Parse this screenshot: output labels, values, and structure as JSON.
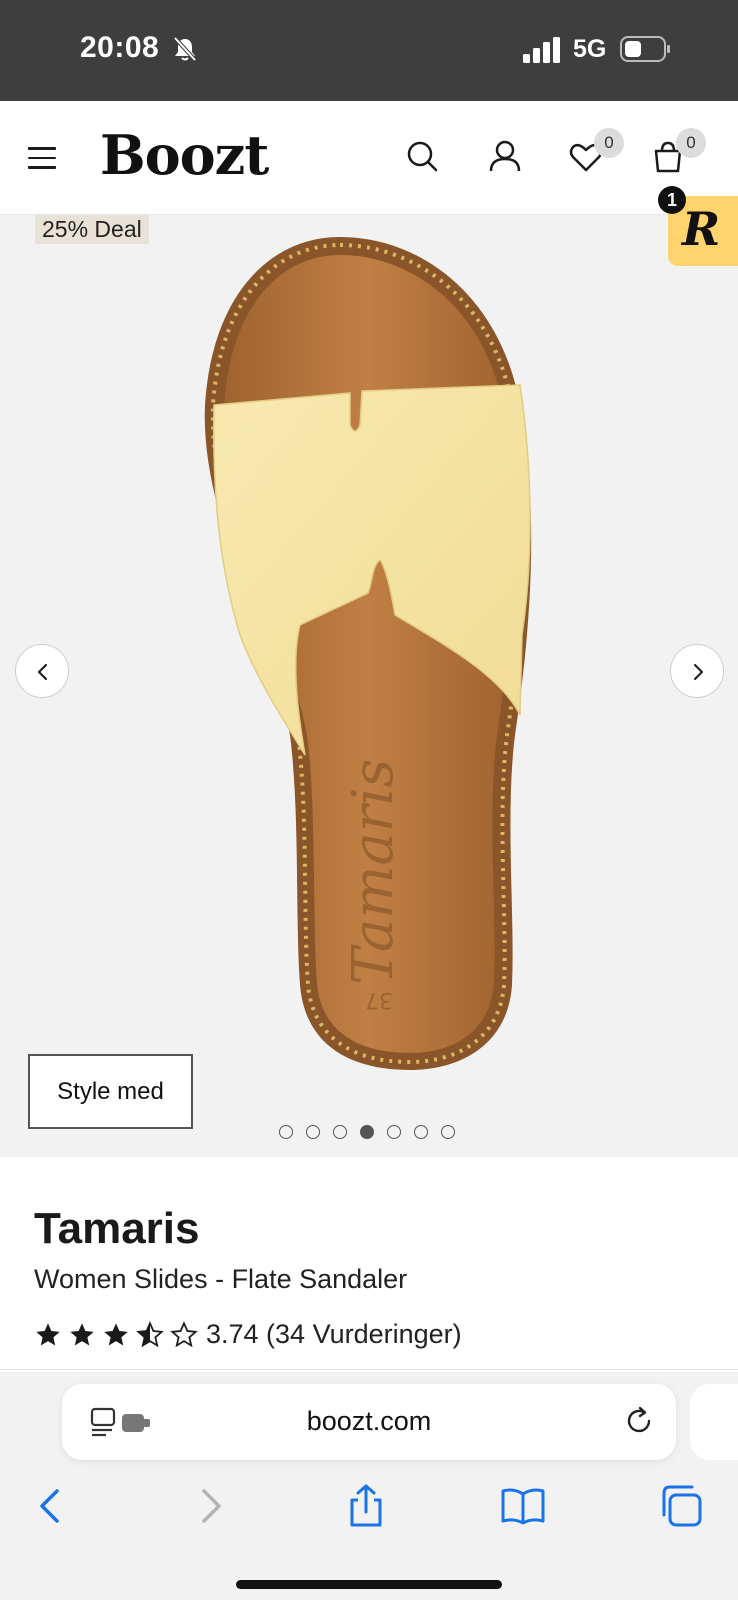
{
  "status_bar": {
    "time": "20:08",
    "network": "5G",
    "icons": [
      "bell-slash-icon",
      "signal-icon",
      "battery-icon"
    ]
  },
  "header": {
    "logo": "Boozt",
    "wishlist_count": "0",
    "cart_count": "0",
    "icons": [
      "menu-icon",
      "search-icon",
      "account-icon",
      "heart-icon",
      "bag-icon"
    ]
  },
  "gallery": {
    "deal_label": "25% Deal",
    "style_button": "Style med",
    "dot_count": 7,
    "active_dot": 4,
    "image_description": "tamaris-slide-sandal",
    "icons": [
      "chevron-left-icon",
      "chevron-right-icon"
    ]
  },
  "reward_widget": {
    "letter": "R",
    "count": "1"
  },
  "product": {
    "brand": "Tamaris",
    "subtitle": "Women Slides - Flate Sandaler",
    "rating_value": 3.74,
    "rating_text": "3.74 (34 Vurderinger)"
  },
  "safari": {
    "url": "boozt.com",
    "icons": [
      "reader-icon",
      "reload-icon",
      "back-icon",
      "forward-icon",
      "share-icon",
      "bookmarks-icon",
      "tabs-icon"
    ]
  },
  "colors": {
    "status_bar": "#3e3e3e",
    "gallery_bg": "#f3f2f2",
    "deal_bg": "#e8e2d6",
    "reward_bg": "#ffd36e",
    "safari_blue": "#1a73e8",
    "sandal_strap": "#f7e7a8",
    "sandal_footbed": "#b8773f"
  }
}
